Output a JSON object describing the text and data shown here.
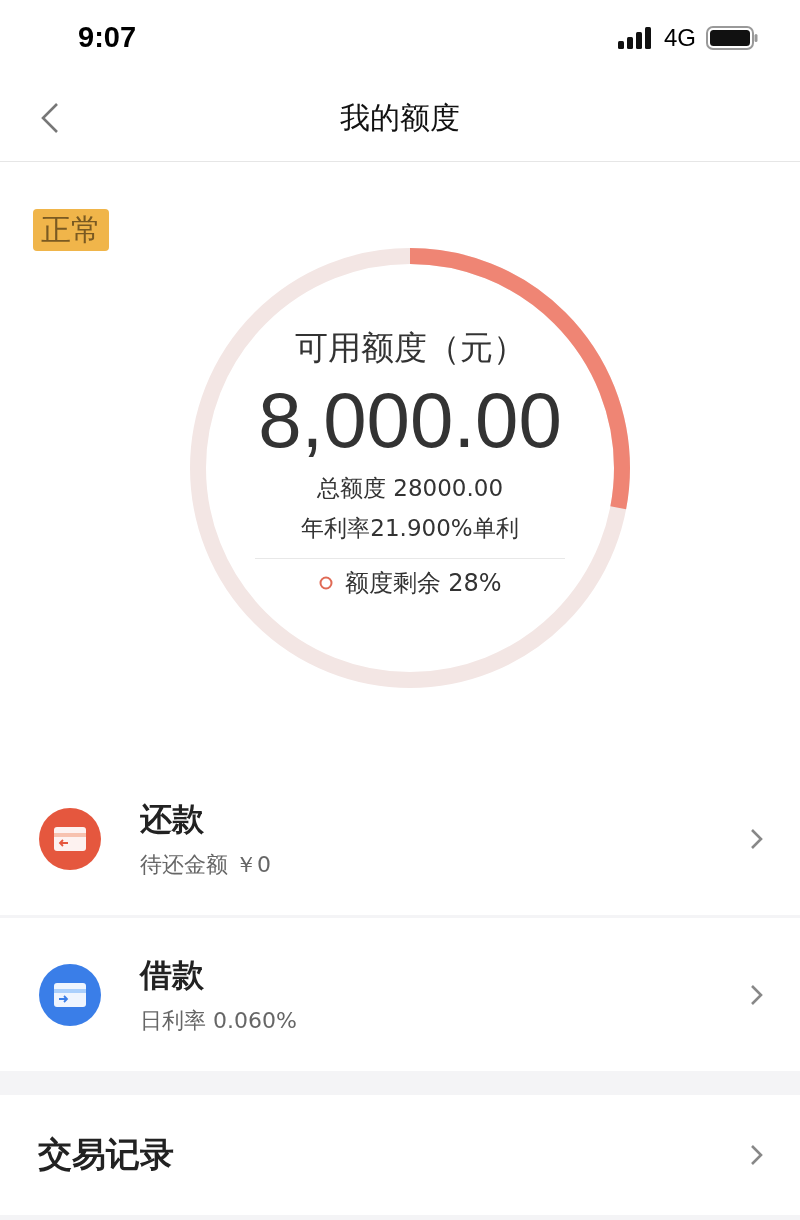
{
  "status_bar": {
    "time": "9:07",
    "network": "4G"
  },
  "nav": {
    "title": "我的额度"
  },
  "quota": {
    "badge": "正常",
    "label": "可用额度（元）",
    "amount": "8,000.00",
    "total": "总额度 28000.00",
    "rate": "年利率21.900%单利",
    "remaining": "额度剩余 28%",
    "level": 0.28
  },
  "actions": [
    {
      "kind": "repay",
      "title": "还款",
      "subtitle": "待还金额 ￥0"
    },
    {
      "kind": "borrow",
      "title": "借款",
      "subtitle": "日利率 0.060%"
    }
  ],
  "records": {
    "title": "交易记录"
  }
}
